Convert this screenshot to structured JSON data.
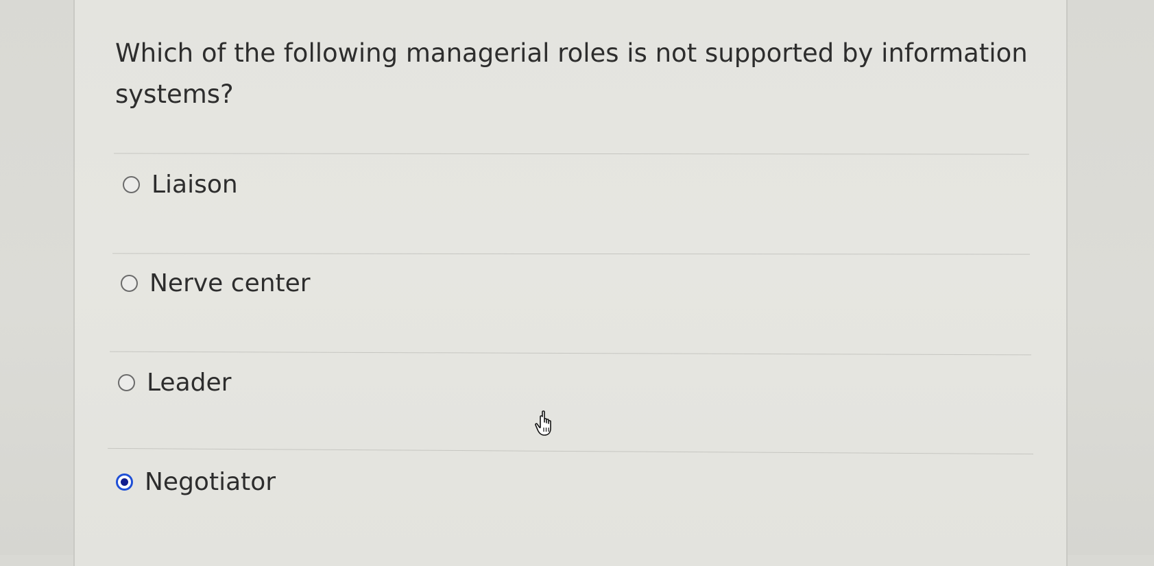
{
  "question": {
    "text": "Which of the following managerial roles is not supported by information systems?"
  },
  "options": [
    {
      "label": "Liaison",
      "selected": false
    },
    {
      "label": "Nerve center",
      "selected": false
    },
    {
      "label": "Leader",
      "selected": false
    },
    {
      "label": "Negotiator",
      "selected": true
    }
  ],
  "colors": {
    "selected_ring": "#1f4fd6",
    "selected_dot": "#121e8f",
    "background": "#e5e5e0"
  },
  "cursor": {
    "icon": "hand-pointer-icon"
  }
}
